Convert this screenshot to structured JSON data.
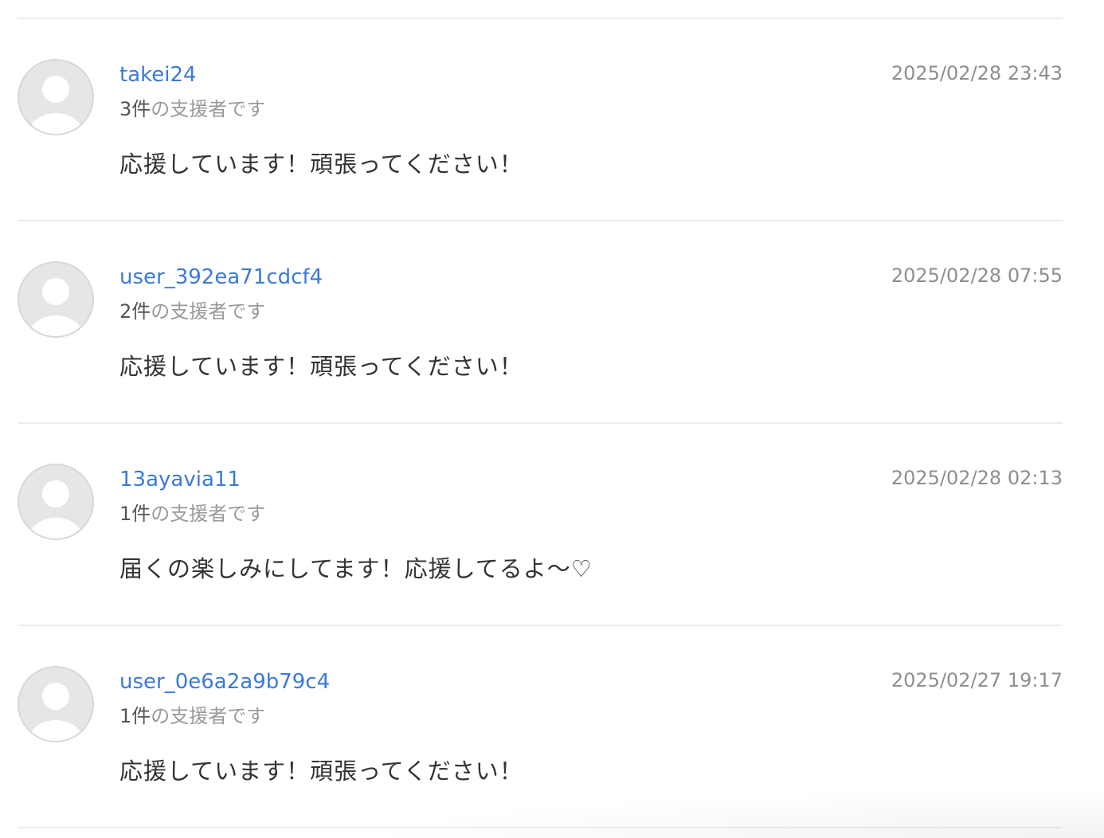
{
  "comments": [
    {
      "user": "takei24",
      "count": "3件",
      "supporter_suffix": "の支援者です",
      "datetime": "2025/02/28 23:43",
      "message": "応援しています！頑張ってください！"
    },
    {
      "user": "user_392ea71cdcf4",
      "count": "2件",
      "supporter_suffix": "の支援者です",
      "datetime": "2025/02/28 07:55",
      "message": "応援しています！頑張ってください！"
    },
    {
      "user": "13ayavia11",
      "count": "1件",
      "supporter_suffix": "の支援者です",
      "datetime": "2025/02/28 02:13",
      "message": "届くの楽しみにしてます！応援してるよ〜♡"
    },
    {
      "user": "user_0e6a2a9b79c4",
      "count": "1件",
      "supporter_suffix": "の支援者です",
      "datetime": "2025/02/27 19:17",
      "message": "応援しています！頑張ってください！"
    }
  ],
  "icons": {
    "avatar": "default-user-avatar-icon"
  },
  "colors": {
    "username_link": "#3b7ad8",
    "meta_text": "#9a9a9a",
    "message_text": "#333333",
    "divider": "#eeeeee",
    "avatar_bg": "#e6e6e6"
  }
}
